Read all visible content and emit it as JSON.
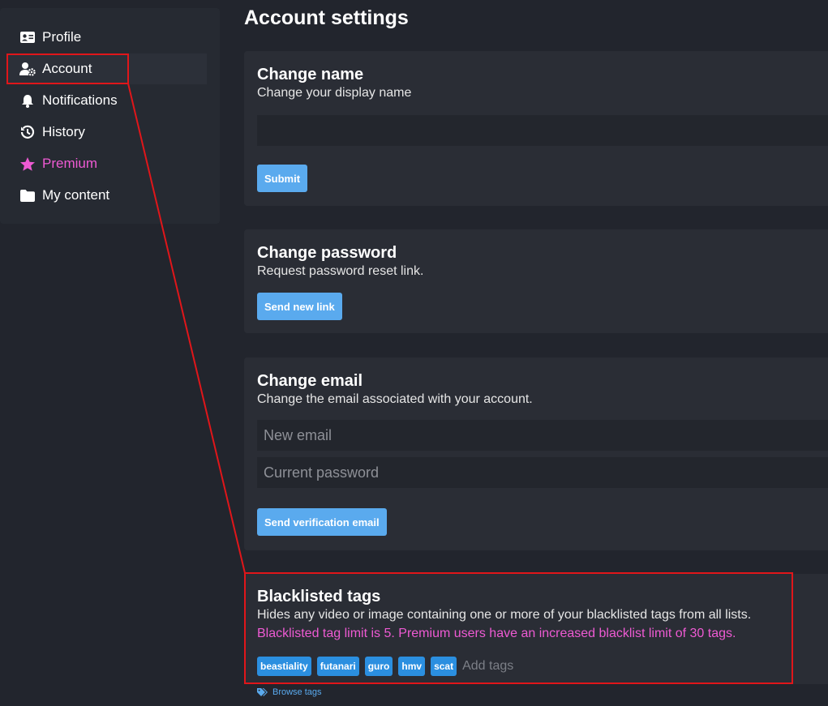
{
  "sidebar": {
    "items": [
      {
        "label": "Profile",
        "icon": "id-card-icon"
      },
      {
        "label": "Account",
        "icon": "user-gear-icon"
      },
      {
        "label": "Notifications",
        "icon": "bell-icon"
      },
      {
        "label": "History",
        "icon": "history-icon"
      },
      {
        "label": "Premium",
        "icon": "star-icon"
      },
      {
        "label": "My content",
        "icon": "folder-icon"
      }
    ],
    "active": "Account"
  },
  "page_title": "Account settings",
  "change_name": {
    "title": "Change name",
    "description": "Change your display name",
    "input_value": "",
    "submit_label": "Submit"
  },
  "change_password": {
    "title": "Change password",
    "description": "Request password reset link.",
    "button_label": "Send new link"
  },
  "change_email": {
    "title": "Change email",
    "description": "Change the email associated with your account.",
    "email_placeholder": "New email",
    "password_placeholder": "Current password",
    "button_label": "Send verification email"
  },
  "blacklist": {
    "title": "Blacklisted tags",
    "description": "Hides any video or image containing one or more of your blacklisted tags from all lists.",
    "limit_note": "Blacklisted tag limit is 5. Premium users have an increased blacklist limit of 30 tags.",
    "tags": [
      "beastiality",
      "futanari",
      "guro",
      "hmv",
      "scat"
    ],
    "add_placeholder": "Add tags",
    "browse_label": "Browse tags"
  },
  "colors": {
    "accent": "#5aaaee",
    "tag": "#2b8fe0",
    "premium": "#ee5ad3",
    "highlight": "#e0161a"
  }
}
